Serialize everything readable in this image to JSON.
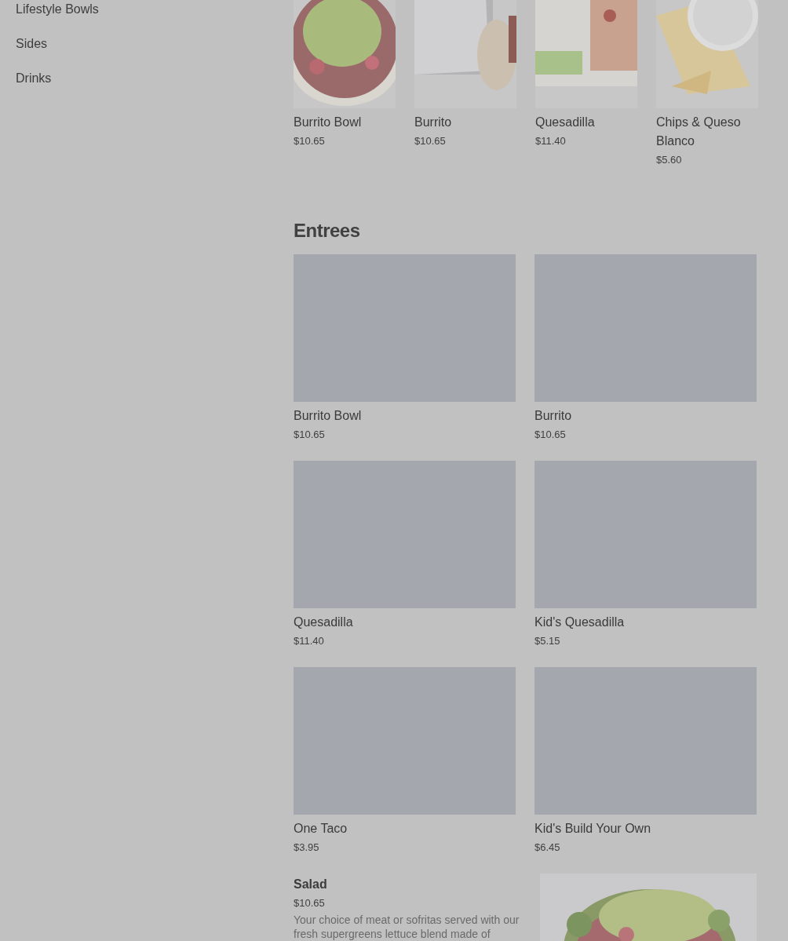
{
  "sidebar": {
    "items": [
      {
        "label": "Lifestyle Bowls"
      },
      {
        "label": "Sides"
      },
      {
        "label": "Drinks"
      }
    ]
  },
  "featured": [
    {
      "name": "Burrito Bowl",
      "price": "$10.65"
    },
    {
      "name": "Burrito",
      "price": "$10.65"
    },
    {
      "name": "Quesadilla",
      "price": "$11.40"
    },
    {
      "name": "Chips & Queso Blanco",
      "price": "$5.60"
    }
  ],
  "entrees": {
    "title": "Entrees",
    "items": [
      {
        "name": "Burrito Bowl",
        "price": "$10.65",
        "image": {
          "kind": "placeholder"
        }
      },
      {
        "name": "Burrito",
        "price": "$10.65",
        "image": {
          "kind": "placeholder"
        }
      },
      {
        "name": "Quesadilla",
        "price": "$11.40",
        "image": {
          "kind": "placeholder"
        }
      },
      {
        "name": "Kid's Quesadilla",
        "price": "$5.15",
        "image": {
          "kind": "placeholder"
        }
      },
      {
        "name": "One Taco",
        "price": "$3.95",
        "image": {
          "kind": "placeholder"
        }
      },
      {
        "name": "Kid's Build Your Own",
        "price": "$6.45",
        "image": {
          "kind": "placeholder"
        }
      }
    ],
    "wide_item": {
      "name": "Salad",
      "price": "$10.65",
      "description": "Your choice of meat or sofritas served with our fresh supergreens lettuce blend made of"
    }
  }
}
